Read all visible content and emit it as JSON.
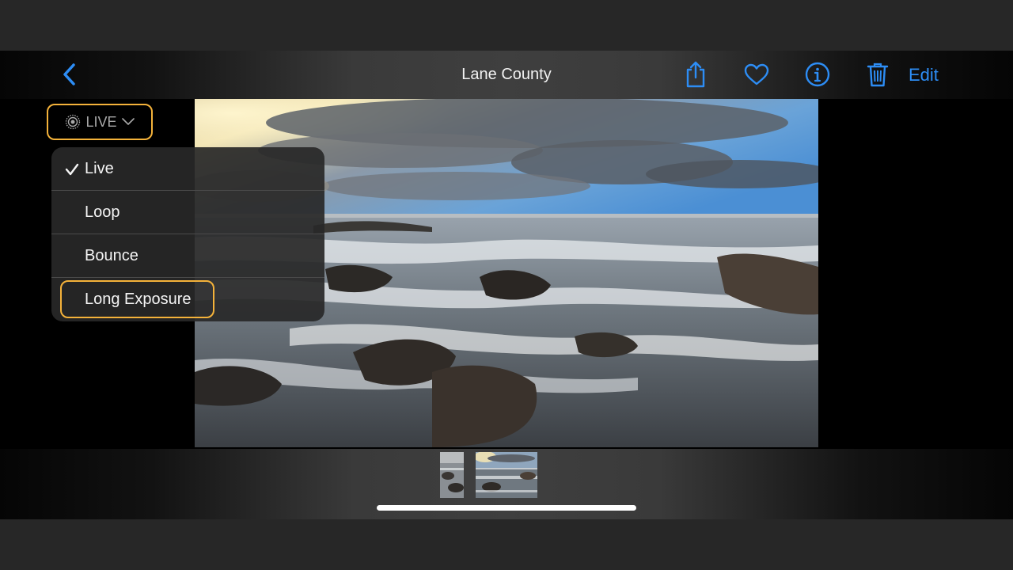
{
  "nav": {
    "title": "Lane County",
    "edit_label": "Edit",
    "icons": [
      "chevron-left-icon",
      "share-icon",
      "heart-icon",
      "info-icon",
      "trash-icon"
    ],
    "accent_color": "#2d8df5"
  },
  "live_badge": {
    "label": "LIVE",
    "icon": "live-photo-icon",
    "highlight_color": "#f4b23a"
  },
  "menu": {
    "items": [
      {
        "label": "Live",
        "selected": true
      },
      {
        "label": "Loop",
        "selected": false
      },
      {
        "label": "Bounce",
        "selected": false
      },
      {
        "label": "Long Exposure",
        "selected": false
      }
    ]
  },
  "thumbnails": {
    "count": 2
  }
}
